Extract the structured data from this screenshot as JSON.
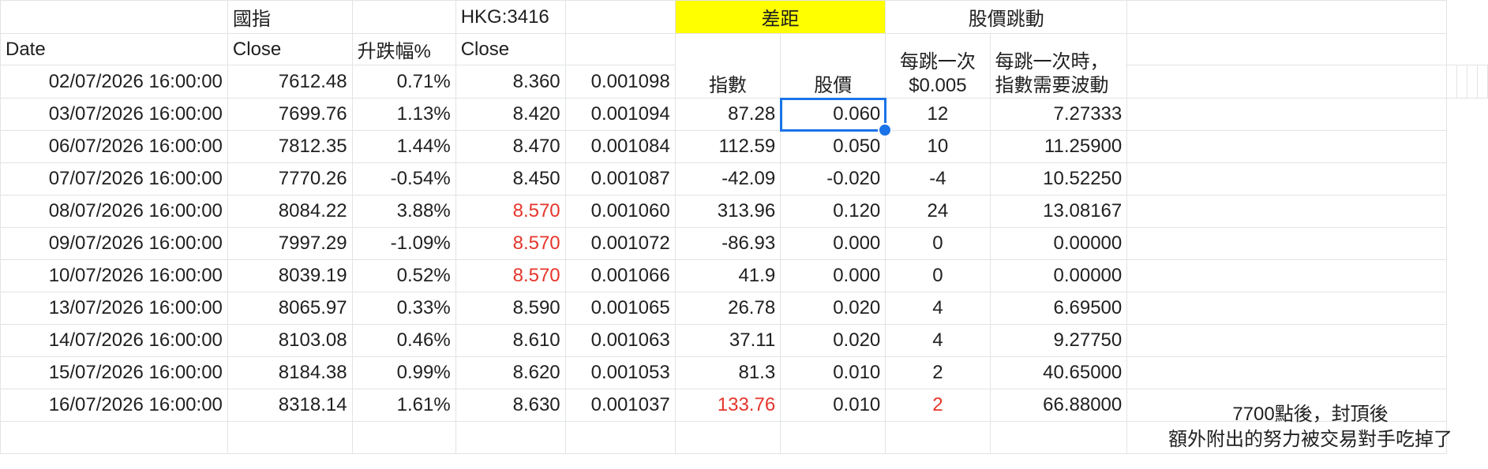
{
  "header_row1": {
    "index_name": "國指",
    "stock_name": "HKG:3416",
    "gap_title": "差距",
    "tick_title": "股價跳動"
  },
  "header_row2": {
    "date": "Date",
    "index_close": "Close",
    "change_pct": "升跌幅%",
    "stock_close": "Close"
  },
  "header_row3": {
    "index_diff": "指數",
    "price_diff": "股價",
    "per_tick_line1": "每跳一次",
    "per_tick_line2": "$0.005",
    "index_per_tick_line1": "每跳一次時，",
    "index_per_tick_line2": "指數需要波動"
  },
  "rows": [
    {
      "date": "02/07/2026 16:00:00",
      "index_close": "7612.48",
      "change": "0.71%",
      "stock_close": "8.360",
      "ratio": "0.001098",
      "index_diff": "",
      "price_diff": "",
      "ticks": "",
      "index_per_tick": ""
    },
    {
      "date": "03/07/2026 16:00:00",
      "index_close": "7699.76",
      "change": "1.13%",
      "stock_close": "8.420",
      "ratio": "0.001094",
      "index_diff": "87.28",
      "price_diff": "0.060",
      "ticks": "12",
      "index_per_tick": "7.27333"
    },
    {
      "date": "06/07/2026 16:00:00",
      "index_close": "7812.35",
      "change": "1.44%",
      "stock_close": "8.470",
      "ratio": "0.001084",
      "index_diff": "112.59",
      "price_diff": "0.050",
      "ticks": "10",
      "index_per_tick": "11.25900"
    },
    {
      "date": "07/07/2026 16:00:00",
      "index_close": "7770.26",
      "change": "-0.54%",
      "stock_close": "8.450",
      "ratio": "0.001087",
      "index_diff": "-42.09",
      "price_diff": "-0.020",
      "ticks": "-4",
      "index_per_tick": "10.52250"
    },
    {
      "date": "08/07/2026 16:00:00",
      "index_close": "8084.22",
      "change": "3.88%",
      "stock_close": "8.570",
      "ratio": "0.001060",
      "index_diff": "313.96",
      "price_diff": "0.120",
      "ticks": "24",
      "index_per_tick": "13.08167"
    },
    {
      "date": "09/07/2026 16:00:00",
      "index_close": "7997.29",
      "change": "-1.09%",
      "stock_close": "8.570",
      "ratio": "0.001072",
      "index_diff": "-86.93",
      "price_diff": "0.000",
      "ticks": "0",
      "index_per_tick": "0.00000"
    },
    {
      "date": "10/07/2026 16:00:00",
      "index_close": "8039.19",
      "change": "0.52%",
      "stock_close": "8.570",
      "ratio": "0.001066",
      "index_diff": "41.9",
      "price_diff": "0.000",
      "ticks": "0",
      "index_per_tick": "0.00000"
    },
    {
      "date": "13/07/2026 16:00:00",
      "index_close": "8065.97",
      "change": "0.33%",
      "stock_close": "8.590",
      "ratio": "0.001065",
      "index_diff": "26.78",
      "price_diff": "0.020",
      "ticks": "4",
      "index_per_tick": "6.69500"
    },
    {
      "date": "14/07/2026 16:00:00",
      "index_close": "8103.08",
      "change": "0.46%",
      "stock_close": "8.610",
      "ratio": "0.001063",
      "index_diff": "37.11",
      "price_diff": "0.020",
      "ticks": "4",
      "index_per_tick": "9.27750"
    },
    {
      "date": "15/07/2026 16:00:00",
      "index_close": "8184.38",
      "change": "0.99%",
      "stock_close": "8.620",
      "ratio": "0.001053",
      "index_diff": "81.3",
      "price_diff": "0.010",
      "ticks": "2",
      "index_per_tick": "40.65000"
    },
    {
      "date": "16/07/2026 16:00:00",
      "index_close": "8318.14",
      "change": "1.61%",
      "stock_close": "8.630",
      "ratio": "0.001037",
      "index_diff": "133.76",
      "price_diff": "0.010",
      "ticks": "2",
      "index_per_tick": "66.88000"
    }
  ],
  "note": {
    "line1": "7700點後，封頂後",
    "line2": "額外附出的努力被交易對手吃掉了"
  },
  "colors": {
    "highlight": "#ffff00",
    "red_text": "#e5352b",
    "selection": "#1a73e8",
    "gridline": "#e2e3e3"
  },
  "selected_cell": "0.060",
  "red_cells": [
    "stock_close row 5",
    "stock_close row 6",
    "stock_close row 7",
    "index_diff row 11",
    "ticks row 11"
  ]
}
